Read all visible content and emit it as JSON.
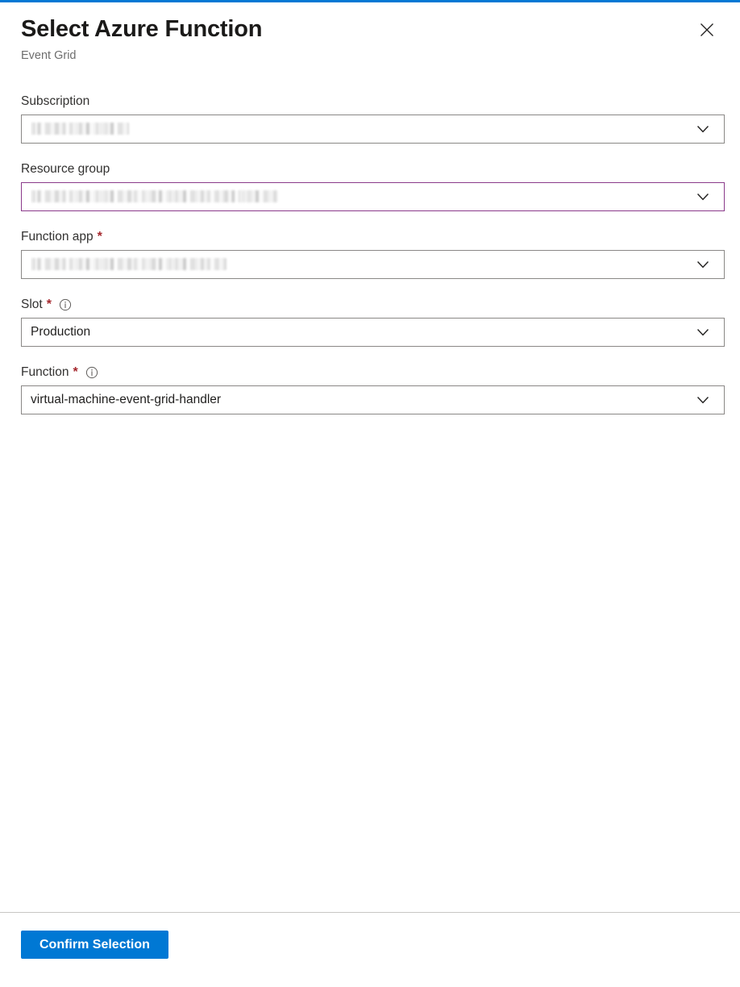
{
  "theme": {
    "accent": "#0078d4",
    "required_star": "#a4262c",
    "visited_border": "#8a3a8a",
    "field_border": "#8a8886",
    "footer_divider": "#c8c6c4",
    "title_color": "#1b1a19",
    "subtitle_color": "#6e6e6e"
  },
  "header": {
    "title": "Select Azure Function",
    "subtitle": "Event Grid",
    "close_icon": "close-icon",
    "close_label": "Close"
  },
  "form": {
    "fields": [
      {
        "id": "subscription",
        "label": "Subscription",
        "required": false,
        "has_info": false,
        "value": "",
        "redacted": true,
        "redaction_width": "w-sub",
        "visited": false,
        "chevron_icon": "chevron-down-icon"
      },
      {
        "id": "resource-group",
        "label": "Resource group",
        "required": false,
        "has_info": false,
        "value": "",
        "redacted": true,
        "redaction_width": "w-rg",
        "visited": true,
        "chevron_icon": "chevron-down-icon"
      },
      {
        "id": "function-app",
        "label": "Function app",
        "required": true,
        "has_info": false,
        "value": "",
        "redacted": true,
        "redaction_width": "w-app",
        "visited": false,
        "chevron_icon": "chevron-down-icon"
      },
      {
        "id": "slot",
        "label": "Slot",
        "required": true,
        "has_info": true,
        "value": "Production",
        "redacted": false,
        "redaction_width": "",
        "visited": false,
        "chevron_icon": "chevron-down-icon"
      },
      {
        "id": "function",
        "label": "Function",
        "required": true,
        "has_info": true,
        "value": "virtual-machine-event-grid-handler",
        "redacted": false,
        "redaction_width": "",
        "visited": false,
        "chevron_icon": "chevron-down-icon"
      }
    ],
    "required_marker": "*",
    "info_icon": "info-icon"
  },
  "footer": {
    "confirm_label": "Confirm Selection"
  }
}
